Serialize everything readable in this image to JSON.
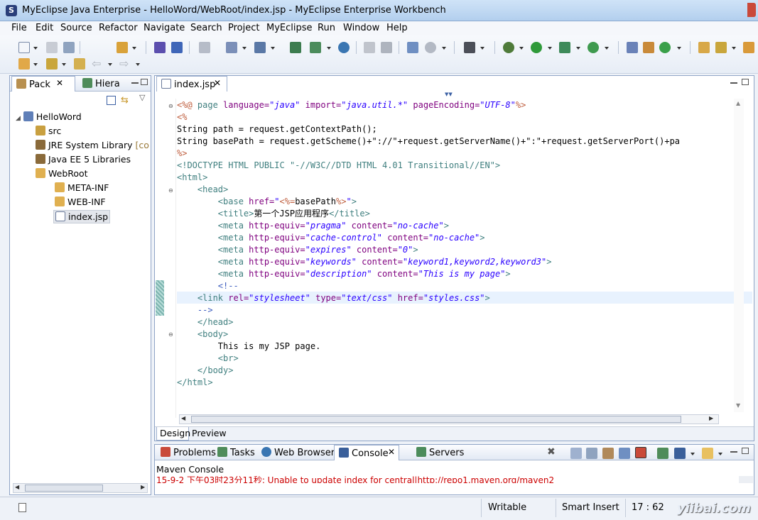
{
  "window": {
    "title": "MyEclipse Java Enterprise - HelloWord/WebRoot/index.jsp - MyEclipse Enterprise Workbench"
  },
  "menu": [
    "File",
    "Edit",
    "Source",
    "Refactor",
    "Navigate",
    "Search",
    "Project",
    "MyEclipse",
    "Run",
    "Window",
    "Help"
  ],
  "left": {
    "tabs": [
      "Pack",
      "Hiera"
    ],
    "tree": [
      {
        "label": "HelloWord",
        "icon": "project-icon",
        "level": 0
      },
      {
        "label": "src",
        "icon": "source-folder-icon",
        "level": 1
      },
      {
        "label": "JRE System Library",
        "suffix": "[co",
        "icon": "library-icon",
        "level": 1
      },
      {
        "label": "Java EE 5 Libraries",
        "icon": "library-icon",
        "level": 1
      },
      {
        "label": "WebRoot",
        "icon": "folder-icon",
        "level": 1
      },
      {
        "label": "META-INF",
        "icon": "folder-icon",
        "level": 2
      },
      {
        "label": "WEB-INF",
        "icon": "folder-icon",
        "level": 2
      },
      {
        "label": "index.jsp",
        "icon": "jsp-file-icon",
        "level": 2
      }
    ]
  },
  "editor": {
    "tab": "index.jsp",
    "lines": [
      [
        [
          "dl",
          "<%@ "
        ],
        [
          "tg",
          "page "
        ],
        [
          "at",
          "language="
        ],
        [
          "sv",
          "\"java\" "
        ],
        [
          "at",
          "import="
        ],
        [
          "sv",
          "\"java.util.*\" "
        ],
        [
          "at",
          "pageEncoding="
        ],
        [
          "sv",
          "\"UTF-8\""
        ],
        [
          "dl",
          "%>"
        ]
      ],
      [
        [
          "dl",
          "<%"
        ]
      ],
      [
        [
          "",
          "String path = request.getContextPath();"
        ]
      ],
      [
        [
          "",
          "String basePath = request.getScheme()+\"://\"+request.getServerName()+\":\"+request.getServerPort()+pa"
        ]
      ],
      [
        [
          "dl",
          "%>"
        ]
      ],
      [
        [
          "dt",
          "<!DOCTYPE HTML PUBLIC \"-//W3C//DTD HTML 4.01 Transitional//EN\">"
        ]
      ],
      [
        [
          "tg",
          "<html>"
        ]
      ],
      [
        [
          "",
          "    "
        ],
        [
          "tg",
          "<head>"
        ]
      ],
      [
        [
          "",
          "        "
        ],
        [
          "tg",
          "<base "
        ],
        [
          "at",
          "href="
        ],
        [
          "sv",
          "\""
        ],
        [
          "dl",
          "<%="
        ],
        [
          "",
          "basePath"
        ],
        [
          "dl",
          "%>"
        ],
        [
          "sv",
          "\""
        ],
        [
          "tg",
          ">"
        ]
      ],
      [
        [
          "",
          "        "
        ],
        [
          "tg",
          "<title>"
        ],
        [
          "",
          "第一个JSP应用程序"
        ],
        [
          "tg",
          "</title>"
        ]
      ],
      [
        [
          "",
          "        "
        ],
        [
          "tg",
          "<meta "
        ],
        [
          "at",
          "http-equiv="
        ],
        [
          "sv",
          "\"pragma\" "
        ],
        [
          "at",
          "content="
        ],
        [
          "sv",
          "\"no-cache\""
        ],
        [
          "tg",
          ">"
        ]
      ],
      [
        [
          "",
          "        "
        ],
        [
          "tg",
          "<meta "
        ],
        [
          "at",
          "http-equiv="
        ],
        [
          "sv",
          "\"cache-control\" "
        ],
        [
          "at",
          "content="
        ],
        [
          "sv",
          "\"no-cache\""
        ],
        [
          "tg",
          ">"
        ]
      ],
      [
        [
          "",
          "        "
        ],
        [
          "tg",
          "<meta "
        ],
        [
          "at",
          "http-equiv="
        ],
        [
          "sv",
          "\"expires\" "
        ],
        [
          "at",
          "content="
        ],
        [
          "sv",
          "\"0\""
        ],
        [
          "tg",
          ">"
        ]
      ],
      [
        [
          "",
          "        "
        ],
        [
          "tg",
          "<meta "
        ],
        [
          "at",
          "http-equiv="
        ],
        [
          "sv",
          "\"keywords\" "
        ],
        [
          "at",
          "content="
        ],
        [
          "sv",
          "\"keyword1,keyword2,keyword3\""
        ],
        [
          "tg",
          ">"
        ]
      ],
      [
        [
          "",
          "        "
        ],
        [
          "tg",
          "<meta "
        ],
        [
          "at",
          "http-equiv="
        ],
        [
          "sv",
          "\"description\" "
        ],
        [
          "at",
          "content="
        ],
        [
          "sv",
          "\"This is my page\""
        ],
        [
          "tg",
          ">"
        ]
      ],
      [
        [
          "",
          "        "
        ],
        [
          "cm",
          "<!--"
        ]
      ],
      [
        [
          "",
          "    "
        ],
        [
          "tg",
          "<link "
        ],
        [
          "at",
          "rel="
        ],
        [
          "sv",
          "\"stylesheet\" "
        ],
        [
          "at",
          "type="
        ],
        [
          "sv",
          "\"text/css\" "
        ],
        [
          "at",
          "href="
        ],
        [
          "sv",
          "\"styles.css\""
        ],
        [
          "tg",
          ">"
        ]
      ],
      [
        [
          "",
          "    "
        ],
        [
          "cm",
          "-->"
        ]
      ],
      [
        [
          "",
          "    "
        ],
        [
          "tg",
          "</head>"
        ]
      ],
      [
        [
          "",
          "    "
        ],
        [
          "tg",
          "<body>"
        ]
      ],
      [
        [
          "",
          "        This is my JSP page."
        ]
      ],
      [
        [
          "",
          "        "
        ],
        [
          "tg",
          "<br>"
        ]
      ],
      [
        [
          "",
          "    "
        ],
        [
          "tg",
          "</body>"
        ]
      ],
      [
        [
          "tg",
          "</html>"
        ]
      ]
    ],
    "bottomTabs": [
      "Design",
      "Preview"
    ]
  },
  "console": {
    "tabs": [
      "Problems",
      "Tasks",
      "Web Browser",
      "Console",
      "Servers"
    ],
    "title": "Maven Console",
    "message": "15-9-2 下午03时23分11秒: Unable to update index for central|http://repo1.maven.org/maven2"
  },
  "status": {
    "mode": "Writable",
    "insert": "Smart Insert",
    "position": "17 : 62",
    "watermark": "yiibai.com"
  }
}
